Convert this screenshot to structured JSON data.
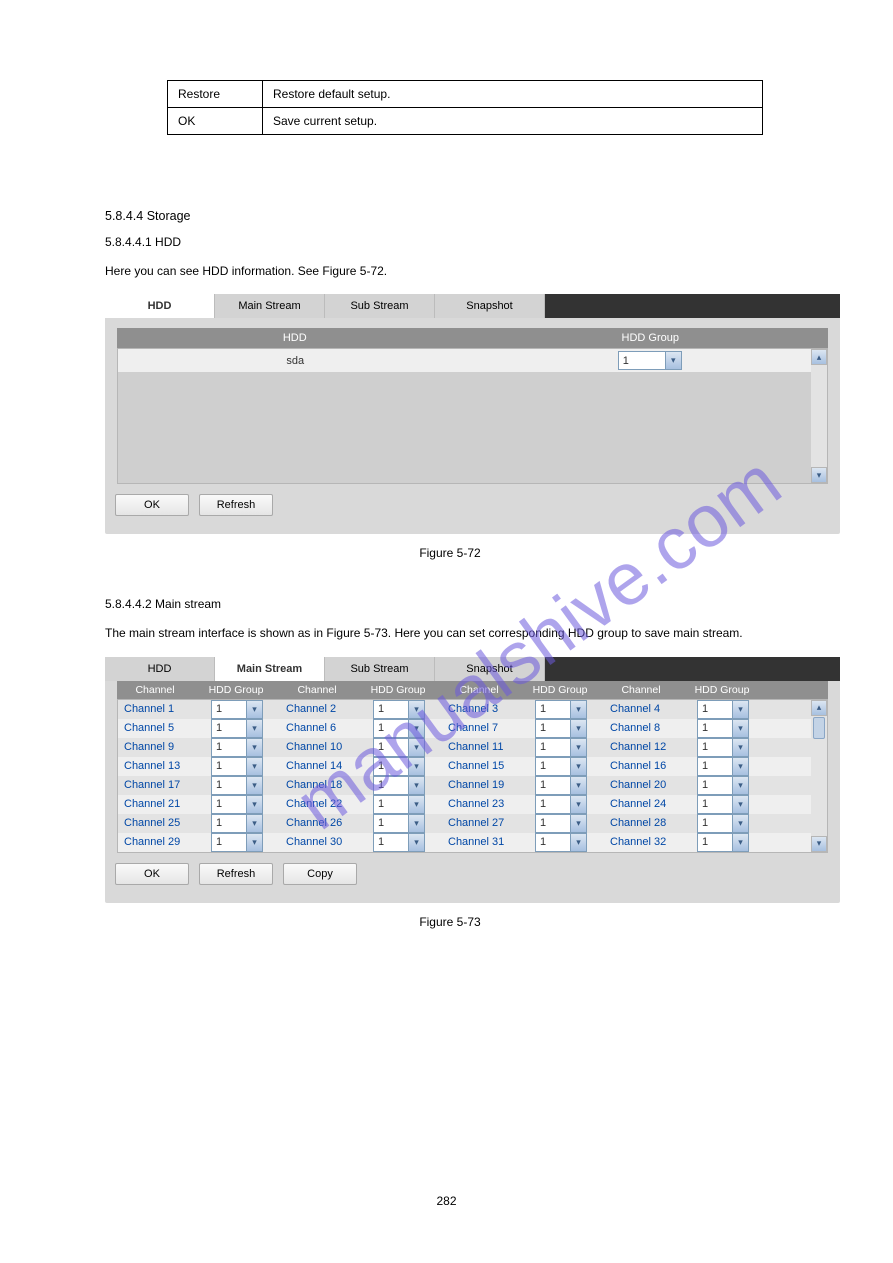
{
  "param_table": {
    "rows": [
      {
        "p": "Restore",
        "f": "Restore default setup."
      },
      {
        "p": "OK",
        "f": "Save current setup."
      }
    ]
  },
  "text": {
    "sec1_title": "5.8.4.4 Storage",
    "sub_hdd_title": "5.8.4.4.1 HDD",
    "sub_hdd_body": "Here you can see HDD information. See Figure 5-72.",
    "fig72": "Figure 5-72",
    "sub_ms_title": "5.8.4.4.2 Main stream",
    "sub_ms_body": "The main stream interface is shown as in Figure 5-73. Here you can set corresponding HDD group to save main stream.",
    "fig73": "Figure 5-73"
  },
  "panel1": {
    "tabs": [
      "HDD",
      "Main Stream",
      "Sub Stream",
      "Snapshot"
    ],
    "active": 0,
    "head": {
      "hdd": "HDD",
      "grp": "HDD Group"
    },
    "rows": [
      {
        "name": "sda",
        "group": "1"
      }
    ],
    "buttons": {
      "ok": "OK",
      "refresh": "Refresh"
    }
  },
  "panel2": {
    "tabs": [
      "HDD",
      "Main Stream",
      "Sub Stream",
      "Snapshot"
    ],
    "active": 1,
    "head": {
      "ch": "Channel",
      "grp": "HDD Group"
    },
    "channels": [
      "Channel 1",
      "Channel 2",
      "Channel 3",
      "Channel 4",
      "Channel 5",
      "Channel 6",
      "Channel 7",
      "Channel 8",
      "Channel 9",
      "Channel 10",
      "Channel 11",
      "Channel 12",
      "Channel 13",
      "Channel 14",
      "Channel 15",
      "Channel 16",
      "Channel 17",
      "Channel 18",
      "Channel 19",
      "Channel 20",
      "Channel 21",
      "Channel 22",
      "Channel 23",
      "Channel 24",
      "Channel 25",
      "Channel 26",
      "Channel 27",
      "Channel 28",
      "Channel 29",
      "Channel 30",
      "Channel 31",
      "Channel 32"
    ],
    "group_value": "1",
    "buttons": {
      "ok": "OK",
      "refresh": "Refresh",
      "copy": "Copy"
    }
  },
  "watermark": "manualshive.com",
  "page_number": "282"
}
